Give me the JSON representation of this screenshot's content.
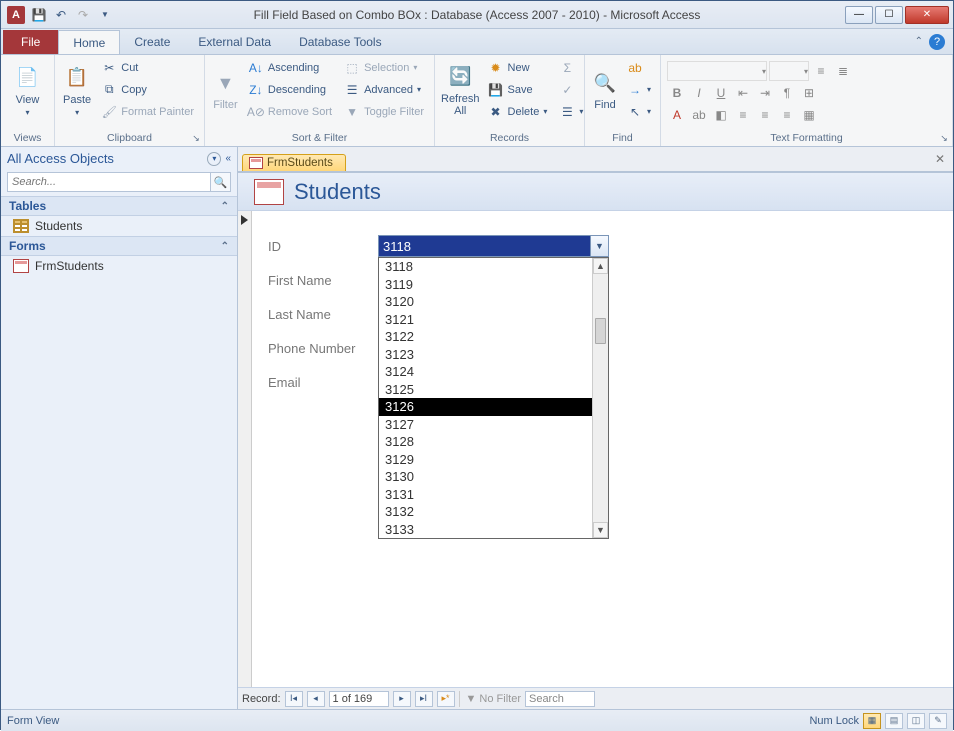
{
  "window": {
    "title": "Fill Field Based on Combo BOx : Database (Access 2007 - 2010)  -  Microsoft Access",
    "app_letter": "A"
  },
  "tabs": {
    "file": "File",
    "items": [
      "Home",
      "Create",
      "External Data",
      "Database Tools"
    ],
    "active_index": 0
  },
  "ribbon": {
    "views": {
      "label": "Views",
      "view": "View"
    },
    "clipboard": {
      "label": "Clipboard",
      "paste": "Paste",
      "cut": "Cut",
      "copy": "Copy",
      "format_painter": "Format Painter"
    },
    "sort_filter": {
      "label": "Sort & Filter",
      "filter": "Filter",
      "asc": "Ascending",
      "desc": "Descending",
      "remove": "Remove Sort",
      "selection": "Selection",
      "advanced": "Advanced",
      "toggle": "Toggle Filter"
    },
    "records": {
      "label": "Records",
      "refresh": "Refresh\nAll",
      "new": "New",
      "save": "Save",
      "delete": "Delete"
    },
    "find": {
      "label": "Find",
      "find": "Find"
    },
    "text_formatting": {
      "label": "Text Formatting"
    }
  },
  "nav": {
    "header": "All Access Objects",
    "search_placeholder": "Search...",
    "sections": {
      "tables": {
        "label": "Tables",
        "items": [
          "Students"
        ]
      },
      "forms": {
        "label": "Forms",
        "items": [
          "FrmStudents"
        ]
      }
    }
  },
  "doc": {
    "tab_label": "FrmStudents",
    "form_title": "Students",
    "fields": {
      "id": "ID",
      "first_name": "First Name",
      "last_name": "Last Name",
      "phone": "Phone Number",
      "email": "Email"
    },
    "combo": {
      "value": "3118",
      "options": [
        "3118",
        "3119",
        "3120",
        "3121",
        "3122",
        "3123",
        "3124",
        "3125",
        "3126",
        "3127",
        "3128",
        "3129",
        "3130",
        "3131",
        "3132",
        "3133"
      ],
      "highlight_index": 8
    }
  },
  "record_nav": {
    "label": "Record:",
    "position": "1 of 169",
    "no_filter": "No Filter",
    "search": "Search"
  },
  "status": {
    "left": "Form View",
    "numlock": "Num Lock"
  }
}
